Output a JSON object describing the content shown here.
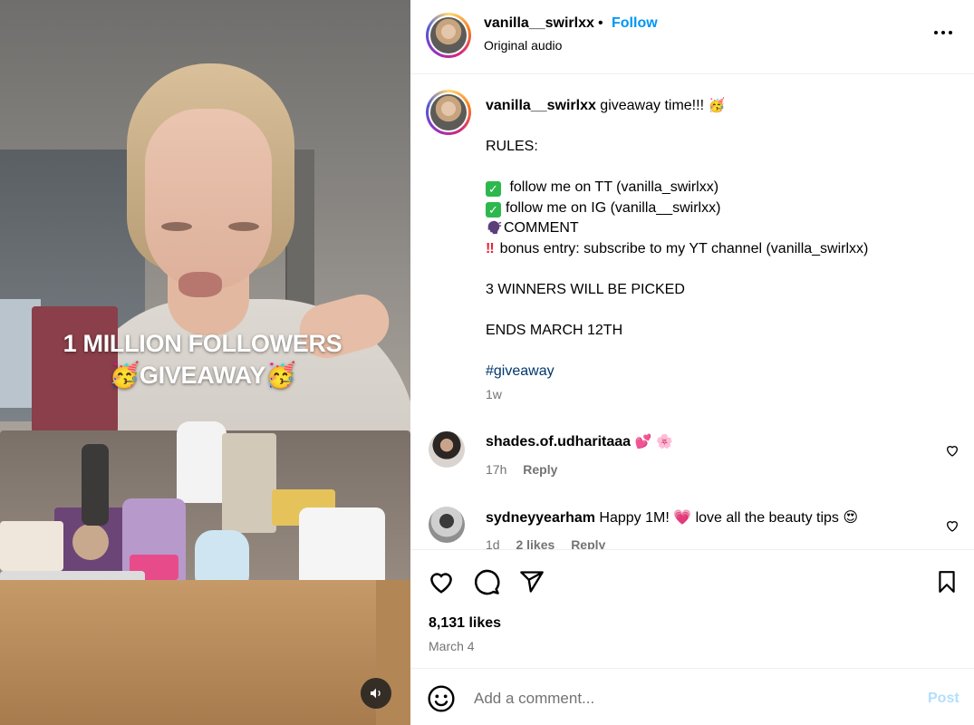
{
  "video": {
    "overlay_line1": "1 MILLION FOLLOWERS",
    "overlay_line2": "GIVEAWAY",
    "overlay_emoji": "🥳",
    "mute_icon": "speaker-icon"
  },
  "header": {
    "username": "vanilla__swirlxx",
    "separator": "•",
    "follow_label": "Follow",
    "subtitle": "Original audio",
    "more_icon": "more-options-icon"
  },
  "caption": {
    "username": "vanilla__swirlxx",
    "text": " giveaway time!!! ",
    "party_emoji": "🥳",
    "rules_title": "RULES:",
    "rule1": " follow me on TT (vanilla_swirlxx)",
    "rule2": "follow me on IG (vanilla__swirlxx)",
    "rule3": "COMMENT",
    "rule4": "bonus entry: subscribe to my YT channel (vanilla_swirlxx)",
    "winners": "3 WINNERS WILL BE PICKED",
    "ends": "ENDS MARCH 12TH",
    "hashtag": "#giveaway",
    "time": "1w"
  },
  "comments": [
    {
      "username": "shades.of.udharitaaa",
      "text": " 💕 🌸",
      "time": "17h",
      "reply_label": "Reply",
      "likes_label": ""
    },
    {
      "username": "sydneyyearham",
      "text": " Happy 1M! 💗 love all the beauty tips 😍",
      "time": "1d",
      "likes_label": "2 likes",
      "reply_label": "Reply"
    }
  ],
  "post": {
    "likes": "8,131 likes",
    "date": "March 4"
  },
  "add_comment": {
    "placeholder": "Add a comment...",
    "post_label": "Post"
  },
  "colors": {
    "follow_blue": "#0095f6",
    "post_disabled": "#b2dffc",
    "hashtag": "#00376b",
    "secondary_text": "#737373"
  }
}
